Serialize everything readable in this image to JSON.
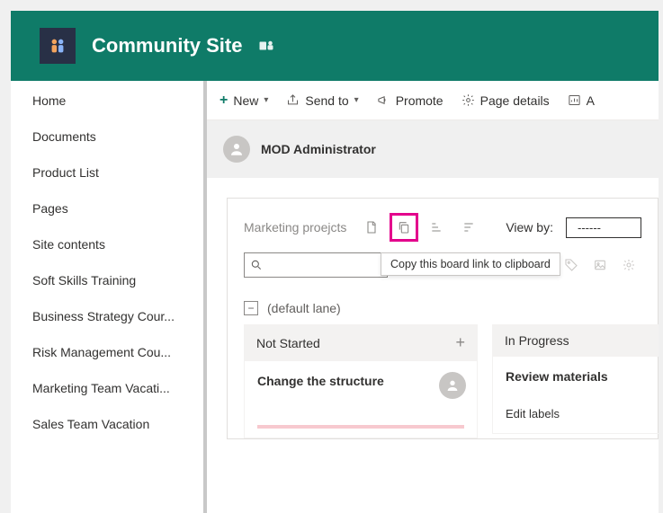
{
  "site": {
    "title": "Community Site"
  },
  "nav": {
    "items": [
      "Home",
      "Documents",
      "Product List",
      "Pages",
      "Site contents",
      "Soft Skills Training",
      "Business Strategy Cour...",
      "Risk Management Cou...",
      "Marketing Team Vacati...",
      "Sales Team Vacation"
    ]
  },
  "cmd": {
    "new": "New",
    "sendto": "Send to",
    "promote": "Promote",
    "pagedetails": "Page details",
    "analytics_prefix": "A"
  },
  "author": {
    "name": "MOD Administrator"
  },
  "board": {
    "name": "Marketing proejcts",
    "viewby_label": "View by:",
    "viewby_value": "------",
    "tooltip": "Copy this board link to clipboard",
    "lane_label": "(default lane)",
    "columns": [
      {
        "title": "Not Started",
        "card_title": "Change the structure"
      },
      {
        "title": "In Progress",
        "card_title": "Review materials",
        "link": "Edit labels"
      }
    ]
  }
}
